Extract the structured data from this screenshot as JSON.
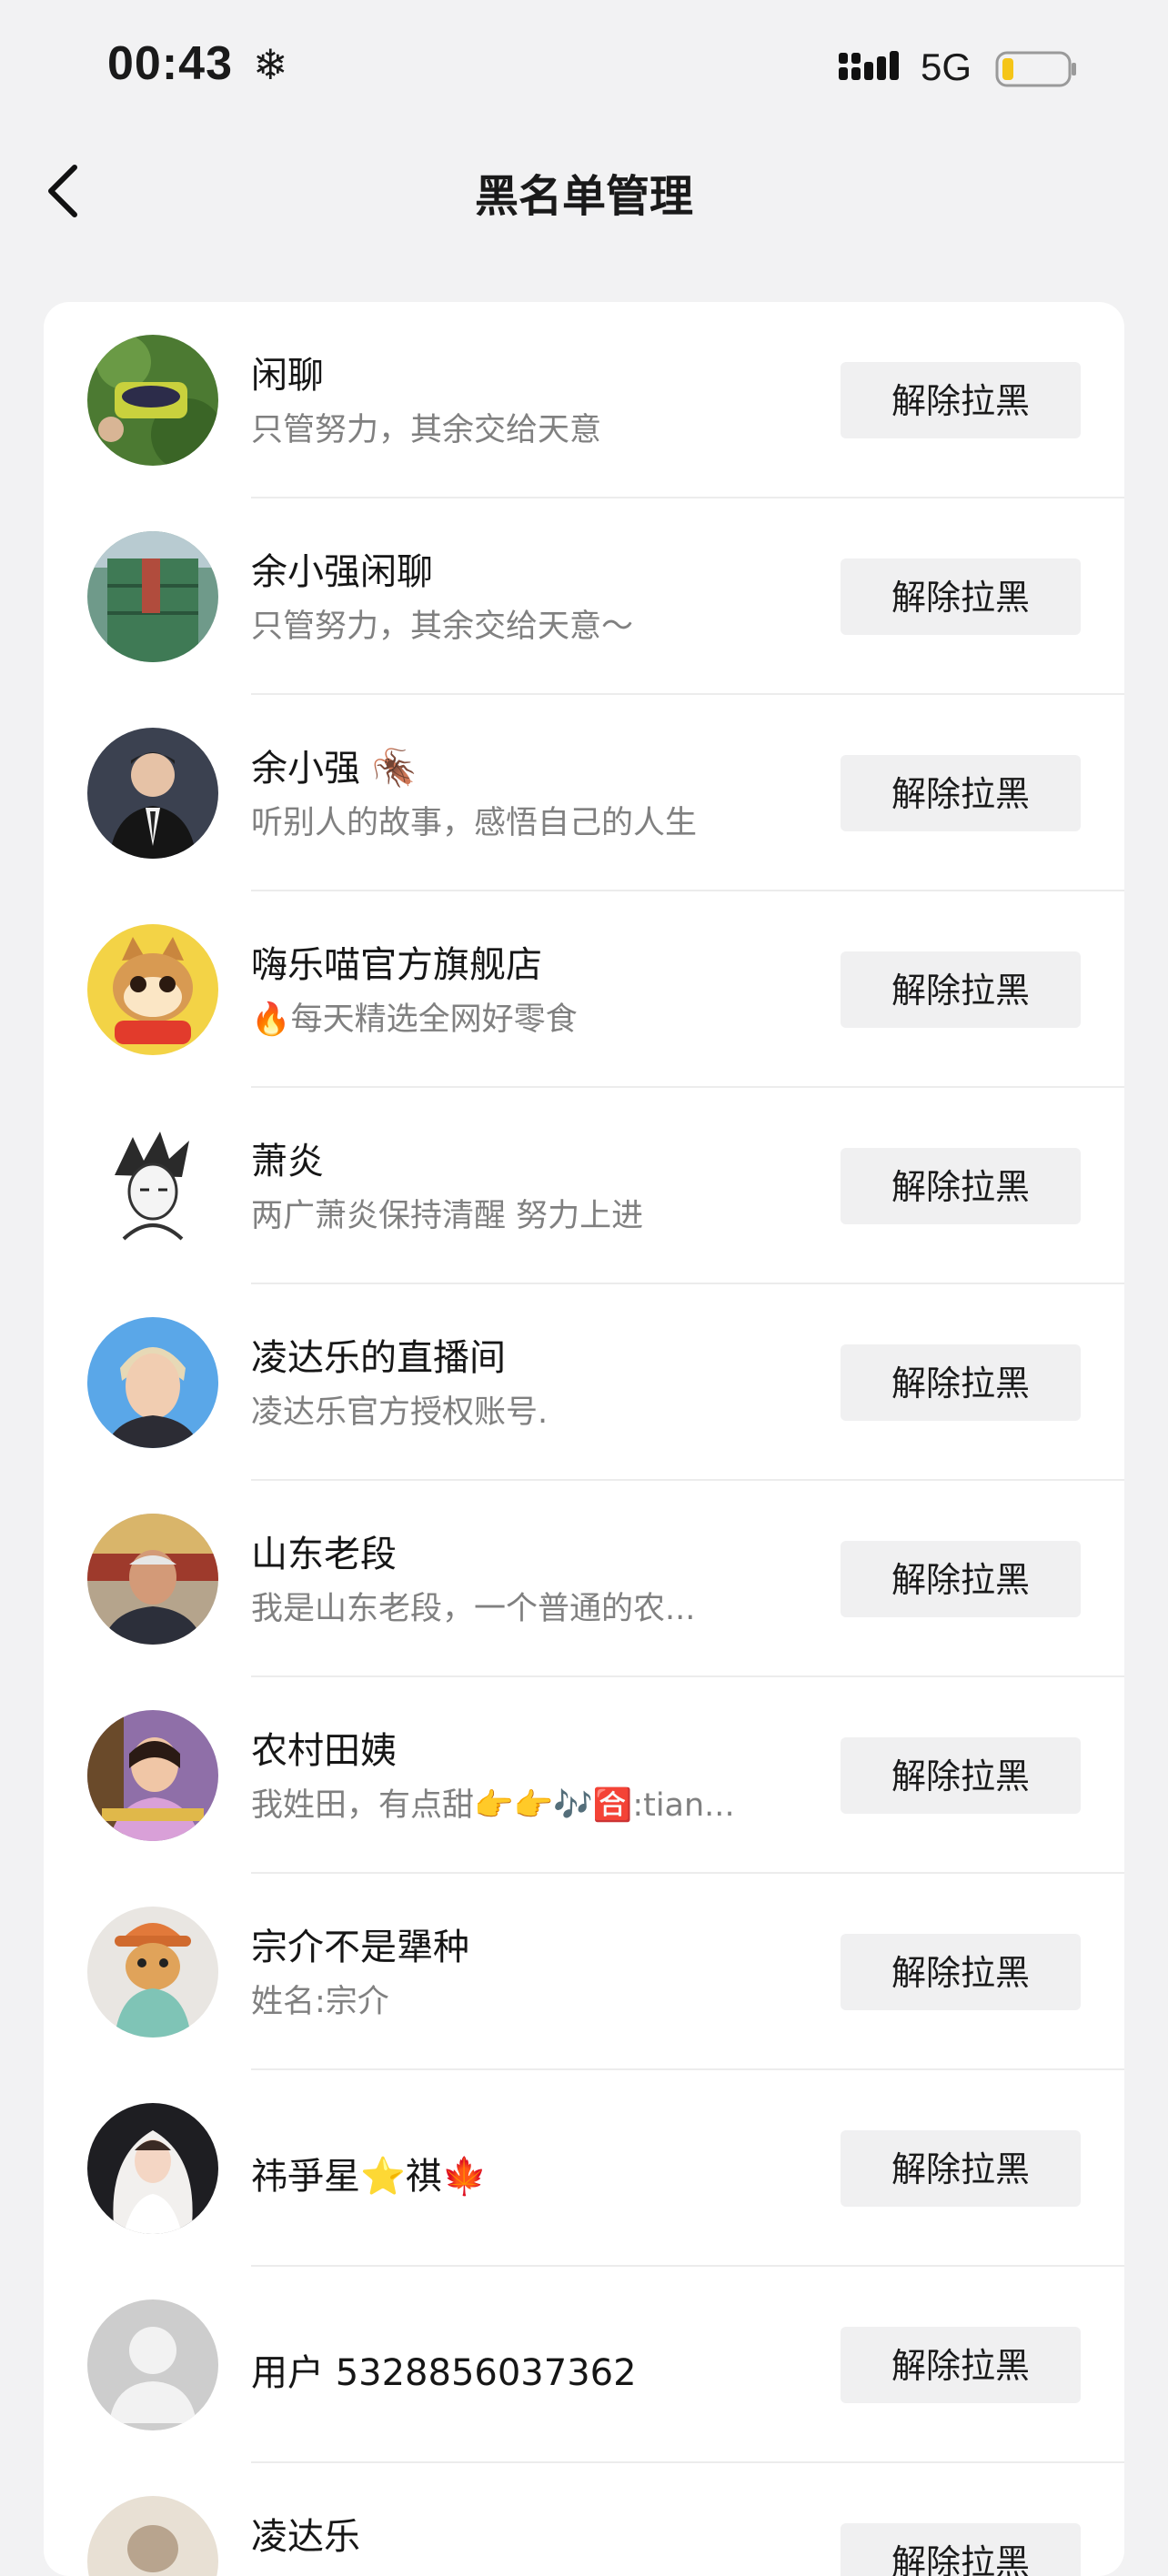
{
  "status_bar": {
    "time": "00:43",
    "snow_glyph": "❄",
    "network": "5G"
  },
  "nav": {
    "title": "黑名单管理"
  },
  "colors": {
    "background": "#f2f2f3",
    "card": "#ffffff",
    "button_bg": "#f0f0f1",
    "bio_text": "#808080",
    "battery_level": "#f5c518"
  },
  "blocked_users": [
    {
      "name": "闲聊",
      "bio": "只管努力，其余交给天意",
      "button": "解除拉黑",
      "avatar_icon": "basket-photo"
    },
    {
      "name": "余小强闲聊",
      "bio": "只管努力，其余交给天意～",
      "button": "解除拉黑",
      "avatar_icon": "building-photo"
    },
    {
      "name": "余小强 🪳",
      "bio": "听别人的故事，感悟自己的人生",
      "button": "解除拉黑",
      "avatar_icon": "man-suit-photo"
    },
    {
      "name": "嗨乐喵官方旗舰店",
      "bio": "🔥每天精选全网好零食",
      "button": "解除拉黑",
      "avatar_icon": "cat-logo"
    },
    {
      "name": "萧炎",
      "bio": "两广萧炎保持清醒 努力上进",
      "button": "解除拉黑",
      "avatar_icon": "anime-sketch"
    },
    {
      "name": "凌达乐的直播间",
      "bio": "凌达乐官方授权账号.",
      "button": "解除拉黑",
      "avatar_icon": "person-photo"
    },
    {
      "name": "山东老段",
      "bio": "我是山东老段，一个普通的农...",
      "button": "解除拉黑",
      "avatar_icon": "old-man-photo"
    },
    {
      "name": "农村田姨",
      "bio": "我姓田，有点甜👉👉🎶🈴:tian...",
      "button": "解除拉黑",
      "avatar_icon": "woman-photo"
    },
    {
      "name": "宗介不是犟种",
      "bio": "姓名:宗介",
      "button": "解除拉黑",
      "avatar_icon": "cat-hat-photo"
    },
    {
      "name": "祎爭星⭐祺🍁",
      "bio": "",
      "button": "解除拉黑",
      "avatar_icon": "bride-photo"
    },
    {
      "name": "用户 5328856037362",
      "bio": "",
      "button": "解除拉黑",
      "avatar_icon": "default-avatar"
    },
    {
      "name": "凌达乐",
      "bio": "",
      "button": "解除拉黑",
      "avatar_icon": "person-photo"
    }
  ]
}
